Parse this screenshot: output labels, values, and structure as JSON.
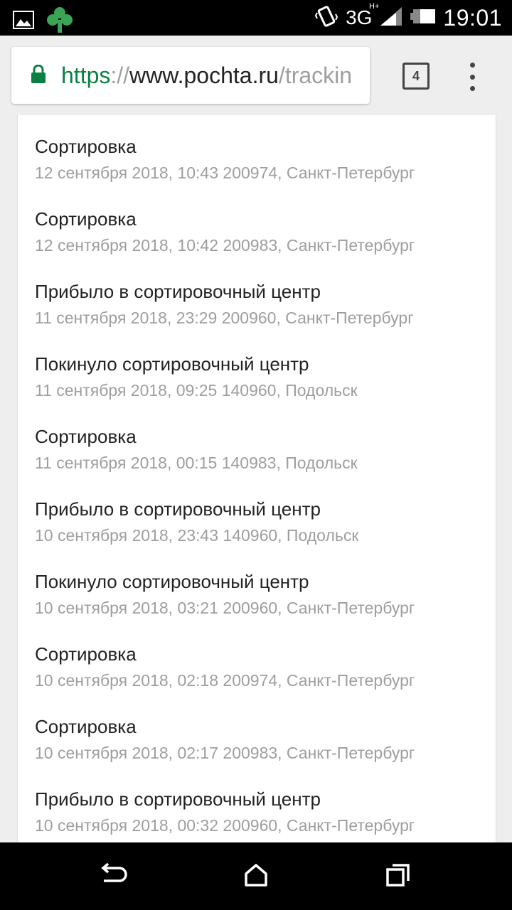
{
  "status_bar": {
    "network": "3G",
    "network_sup": "H+",
    "time": "19:01",
    "icons": [
      "gallery-icon",
      "app-clover-icon",
      "vibrate-icon",
      "signal-icon",
      "battery-icon"
    ]
  },
  "browser": {
    "url_scheme": "https",
    "url_sep": "://",
    "url_host": "www.pochta.ru",
    "url_path": "/trackin",
    "tab_count": "4",
    "accent": "#0b8043"
  },
  "events": [
    {
      "title": "Сортировка",
      "meta": "12 сентября 2018, 10:43 200974, Санкт-Петербург"
    },
    {
      "title": "Сортировка",
      "meta": "12 сентября 2018, 10:42 200983, Санкт-Петербург"
    },
    {
      "title": "Прибыло в сортировочный центр",
      "meta": "11 сентября 2018, 23:29 200960, Санкт-Петербург"
    },
    {
      "title": "Покинуло сортировочный центр",
      "meta": "11 сентября 2018, 09:25 140960, Подольск"
    },
    {
      "title": "Сортировка",
      "meta": "11 сентября 2018, 00:15 140983, Подольск"
    },
    {
      "title": "Прибыло в сортировочный центр",
      "meta": "10 сентября 2018, 23:43 140960, Подольск"
    },
    {
      "title": "Покинуло сортировочный центр",
      "meta": "10 сентября 2018, 03:21 200960, Санкт-Петербург"
    },
    {
      "title": "Сортировка",
      "meta": "10 сентября 2018, 02:18 200974, Санкт-Петербург"
    },
    {
      "title": "Сортировка",
      "meta": "10 сентября 2018, 02:17 200983, Санкт-Петербург"
    },
    {
      "title": "Прибыло в сортировочный центр",
      "meta": "10 сентября 2018, 00:32 200960, Санкт-Петербург"
    }
  ],
  "nav_bar": {
    "icons": [
      "back-icon",
      "home-icon",
      "recents-icon"
    ]
  }
}
